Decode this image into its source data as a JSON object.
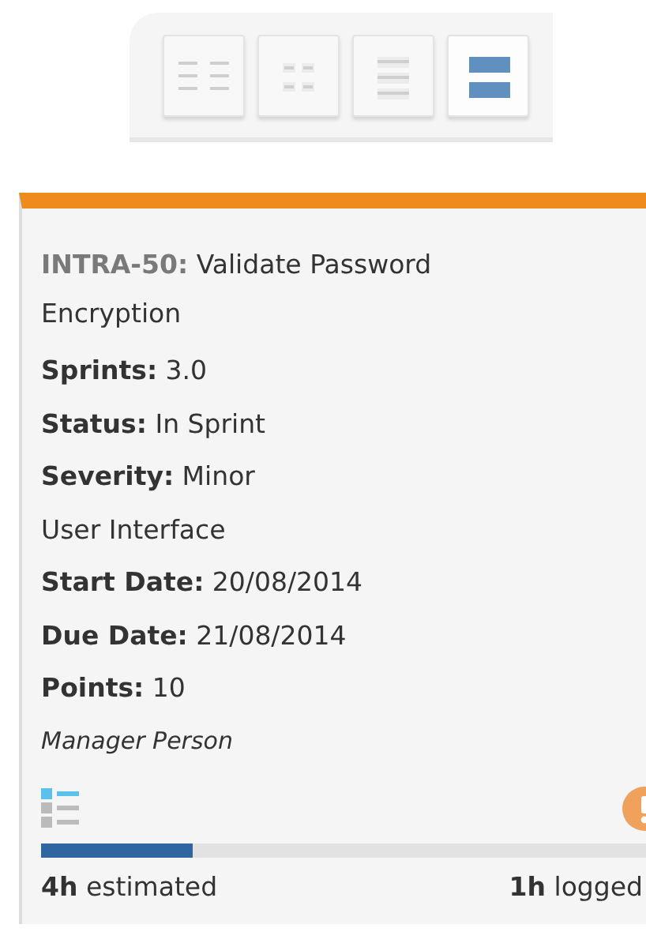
{
  "view_buttons": [
    {
      "kind": "list-grid",
      "selected": false
    },
    {
      "kind": "small-grid",
      "selected": false
    },
    {
      "kind": "rows",
      "selected": false
    },
    {
      "kind": "cards",
      "selected": true
    }
  ],
  "card": {
    "key": "INTRA-50:",
    "title": "Validate Password Encryption",
    "lines": [
      {
        "kind": "field",
        "label": "Sprints:",
        "value": "3.0"
      },
      {
        "kind": "field",
        "label": "Status:",
        "value": "In Sprint"
      },
      {
        "kind": "field",
        "label": "Severity:",
        "value": "Minor"
      },
      {
        "kind": "text",
        "text": "User Interface"
      },
      {
        "kind": "field",
        "label": "Start Date:",
        "value": "20/08/2014"
      },
      {
        "kind": "field",
        "label": "Due Date:",
        "value": "21/08/2014"
      },
      {
        "kind": "field",
        "label": "Points:",
        "value": "10"
      },
      {
        "kind": "note",
        "text": "Manager Person"
      }
    ],
    "warning": true,
    "progress": {
      "level": 0.25
    },
    "estimated": {
      "amount": "4h",
      "label": "estimated"
    },
    "logged": {
      "amount": "1h",
      "label": "logged"
    }
  }
}
